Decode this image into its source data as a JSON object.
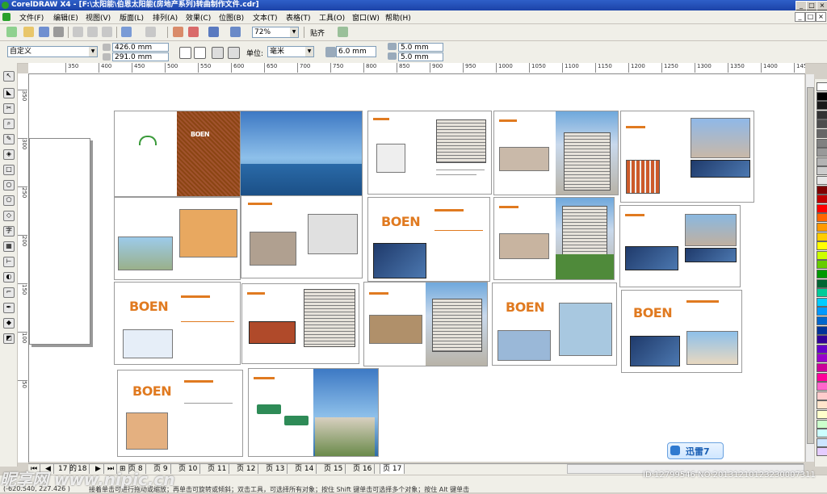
{
  "window": {
    "title": "CorelDRAW X4 - [F:\\太阳能\\伯恩太阳能(房地产系列)转曲制作文件.cdr]",
    "controls": [
      "_",
      "□",
      "×"
    ]
  },
  "menu": {
    "items": [
      "文件(F)",
      "编辑(E)",
      "视图(V)",
      "版面(L)",
      "排列(A)",
      "效果(C)",
      "位图(B)",
      "文本(T)",
      "表格(T)",
      "工具(O)",
      "窗口(W)",
      "帮助(H)"
    ]
  },
  "toolbar": {
    "zoom": "72%",
    "snap_label": "贴齐"
  },
  "property_bar": {
    "preset": "自定义",
    "width": "426.0 mm",
    "height": "291.0 mm",
    "units_label": "单位:",
    "units_value": "毫米",
    "nudge": "6.0 mm",
    "dup_x": "5.0 mm",
    "dup_y": "5.0 mm"
  },
  "ruler": {
    "h_ticks": [
      "350",
      "400",
      "450",
      "500",
      "550",
      "600",
      "650",
      "700",
      "750",
      "800",
      "850",
      "900",
      "950",
      "1000",
      "1050",
      "1100",
      "1150",
      "1200",
      "1250",
      "1300",
      "1350",
      "1400",
      "1450"
    ],
    "v_ticks": [
      "350",
      "300",
      "250",
      "200",
      "150",
      "100",
      "50"
    ]
  },
  "spreads": {
    "logo_text": "BOEN"
  },
  "page_tabs": {
    "current": "17",
    "total": "18",
    "tabs": [
      "页 8",
      "页 9",
      "页 10",
      "页 11",
      "页 12",
      "页 13",
      "页 14",
      "页 15",
      "页 16",
      "页 17"
    ]
  },
  "status": {
    "coordinates": "(-620.540, 227.426 )",
    "hint": "接着单击可进行拖动或缩放；再单击可旋转或倾斜；双击工具，可选择所有对象；按住 Shift 键单击可选择多个对象；按住 Alt 键单击"
  },
  "watermark": {
    "site": "昵享网 www.nipic.cn",
    "id": "ID:12799546 NO:20131210123230007311"
  },
  "badge": {
    "label": "迅雷7"
  },
  "palette_colors": [
    "#ffffff",
    "#000000",
    "#1a1a1a",
    "#333333",
    "#4d4d4d",
    "#666666",
    "#808080",
    "#999999",
    "#b3b3b3",
    "#cccccc",
    "#e6e6e6",
    "#7f0000",
    "#c00000",
    "#ff0000",
    "#ff6600",
    "#ff9900",
    "#ffcc00",
    "#ffff00",
    "#ccff00",
    "#66cc00",
    "#009900",
    "#006633",
    "#00cc99",
    "#00ccff",
    "#0099ff",
    "#0066cc",
    "#003399",
    "#330099",
    "#6600cc",
    "#9900cc",
    "#cc0099",
    "#ff0099",
    "#ff66cc",
    "#ffcccc",
    "#ffe5cc",
    "#ffffcc",
    "#ccffcc",
    "#ccffff",
    "#cce5ff",
    "#e5ccff"
  ]
}
